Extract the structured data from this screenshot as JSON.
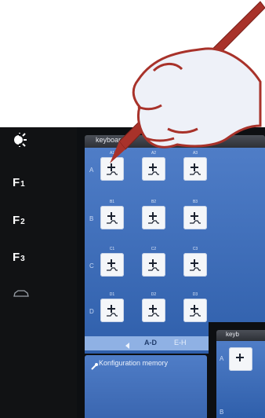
{
  "sidebar": {
    "items": [
      {
        "icon": "brightness-icon"
      },
      {
        "letter": "F",
        "sub": "1"
      },
      {
        "letter": "F",
        "sub": "2"
      },
      {
        "letter": "F",
        "sub": "3"
      },
      {
        "icon": "car-icon"
      }
    ]
  },
  "keyboard": {
    "title": "keyboard",
    "rows": [
      {
        "letter": "A",
        "keys": [
          "A1",
          "A2",
          "A3"
        ]
      },
      {
        "letter": "B",
        "keys": [
          "B1",
          "B2",
          "B3"
        ]
      },
      {
        "letter": "C",
        "keys": [
          "C1",
          "C2",
          "C3"
        ]
      },
      {
        "letter": "D",
        "keys": [
          "D1",
          "D2",
          "D3"
        ]
      }
    ],
    "footer": {
      "current": "A-D",
      "next": "E-H"
    }
  },
  "config": {
    "label": "Konfiguration memory"
  },
  "inset": {
    "title": "keyb",
    "row_letters": [
      "A",
      "B"
    ]
  },
  "colors": {
    "panel_blue": "#3f6fbd",
    "sidebar_bg": "#111214",
    "hand_red": "#a8322a"
  }
}
